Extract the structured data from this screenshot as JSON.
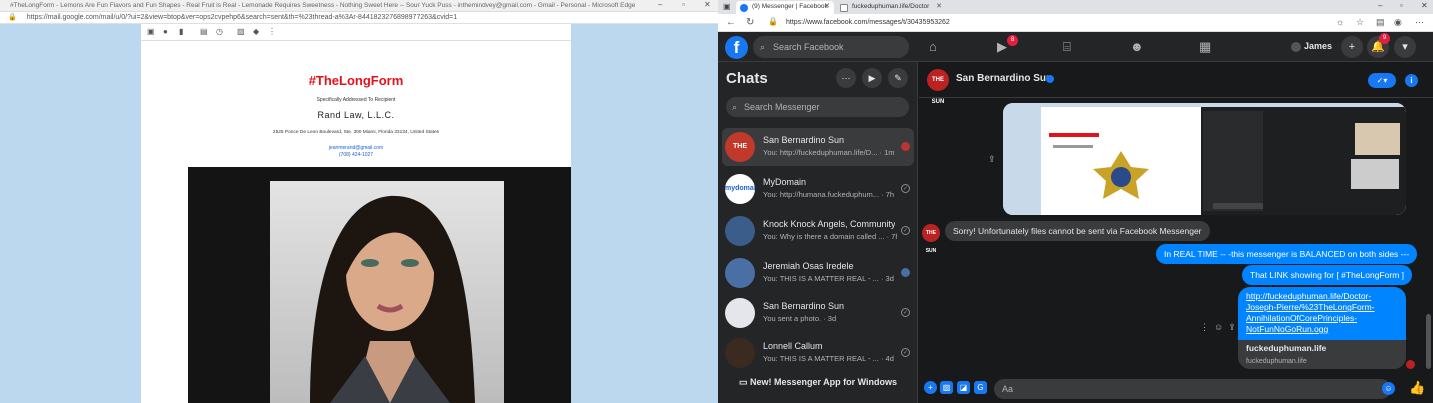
{
  "left_window": {
    "title": "#TheLongForm - Lemons Are Fun Flavors and Fun Shapes - Real Fruit is Real - Lemonade Requires Sweetness - Nothing Sweet Here -- Sour Yuck Puss - inthemindvey@gmail.com - Gmail - Personal - Microsoft Edge",
    "url": "https://mail.google.com/mail/u/0/?ui=2&view=btop&ver=ops2cvpehp6&search=sent&th=%23thread-a%3Ar-8441823276898977263&cvid=1",
    "mail": {
      "brand": "#TheLongForm",
      "addressed": "Specifically Addressed To Recipient",
      "firm": "Rand Law, L.L.C.",
      "street": "2525 Ponce De Leon Boulevard, Ste. 300 Miami, Florida 33134, United States",
      "email": "jeanmerand@gmail.com",
      "phone": "(708) 424-1027"
    }
  },
  "right_window": {
    "tabs": [
      {
        "label": "(9) Messenger | Facebook"
      },
      {
        "label": "fuckeduphuman.life/Doctor"
      }
    ],
    "url": "https://www.facebook.com/messages/t/304359532626",
    "url_display": "https://www.facebook.com/messages/t/30435953262",
    "topbar": {
      "search_placeholder": "Search Facebook",
      "watch_badge": "8",
      "user_name": "James",
      "notif_badge": "9"
    },
    "chats": {
      "title": "Chats",
      "search_placeholder": "Search Messenger",
      "new_app": "New! Messenger App for Windows",
      "items": [
        {
          "name": "San Bernardino Sun",
          "preview": "You: http://fuckeduphuman.life/D...",
          "time": "· 1m",
          "avatar_text": "THE SUN",
          "selected": true
        },
        {
          "name": "MyDomain",
          "preview": "You: http://humana.fuckeduphum...",
          "time": "· 7h",
          "avatar_text": "mydomain"
        },
        {
          "name": "Knock Knock Angels, Community...",
          "preview": "You: Why is there a domain called ...",
          "time": "· 7h",
          "avatar_text": ""
        },
        {
          "name": "Jeremiah Osas Iredele",
          "preview": "You: THIS IS A MATTER REAL - ...",
          "time": "· 3d",
          "avatar_text": ""
        },
        {
          "name": "San Bernardino Sun",
          "preview": "You sent a photo.",
          "time": "· 3d",
          "avatar_text": ""
        },
        {
          "name": "Lonnell Callum",
          "preview": "You: THIS IS A MATTER REAL - ...",
          "time": "· 4d",
          "avatar_text": ""
        }
      ]
    },
    "conversation": {
      "name": "San Bernardino Sun",
      "avatar_text": "THE SUN",
      "messages": [
        {
          "from": "them",
          "text": "Sorry! Unfortunately files cannot be sent via Facebook Messenger"
        },
        {
          "from": "me",
          "text": "In REAL TIME -- -this messenger is BALANCED on both sides ---"
        },
        {
          "from": "me",
          "text": "That LINK showing for [ #TheLongForm ]"
        }
      ],
      "link_message": {
        "url_lines": [
          "http://fuckeduphuman.life/Doctor-",
          "Joseph-Pierre/%23TheLongForm-",
          "AnnihilationOfCorePrinciples-",
          "NotFunNoGoRun.ogg"
        ],
        "title": "fuckeduphuman.life",
        "domain": "fuckeduphuman.life"
      },
      "composer_placeholder": "Aa"
    }
  },
  "colors": {
    "fb_blue": "#1877f2",
    "messenger_out": "#0084ff",
    "brand_red": "#e1121b",
    "dark_bg": "#18191a"
  }
}
